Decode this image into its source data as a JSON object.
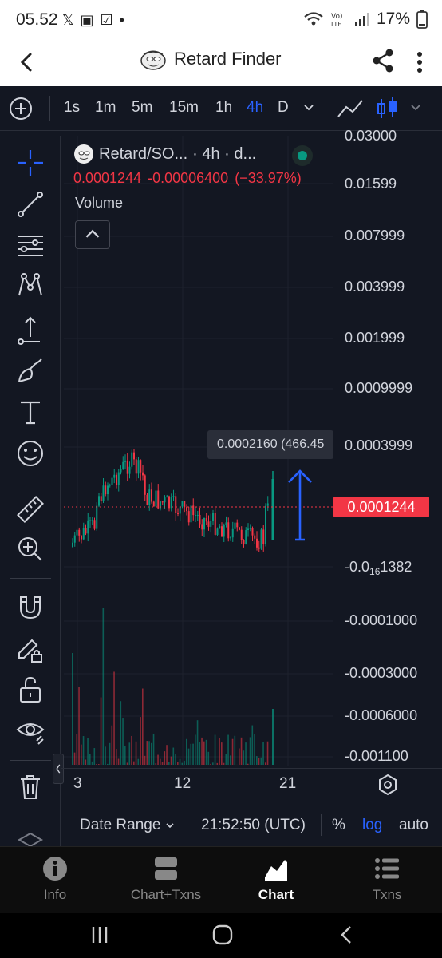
{
  "status": {
    "time": "05.52",
    "battery": "17%"
  },
  "app": {
    "title": "Retard Finder"
  },
  "toolbar": {
    "timeframes": [
      "1s",
      "1m",
      "5m",
      "15m",
      "1h",
      "4h",
      "D"
    ],
    "active_timeframe": "4h"
  },
  "legend": {
    "symbol": "Retard/SO...",
    "interval": "· 4h · d...",
    "last": "0.0001244",
    "change": "-0.00006400",
    "change_pct": "(−33.97%)",
    "volume_label": "Volume"
  },
  "price_axis": {
    "labels": [
      "0.03000",
      "0.01599",
      "0.007999",
      "0.003999",
      "0.001999",
      "0.0009999",
      "0.0003999",
      "-0.0001000",
      "-0.0003000",
      "-0.0006000",
      "-0.001100"
    ],
    "sub_label_prefix": "-0.0",
    "sub_label_sub": "16",
    "sub_label_suffix": "1382",
    "current_price": "0.0001244",
    "tooltip": "0.0002160 (466.45"
  },
  "time_axis": {
    "ticks": [
      "3",
      "12",
      "21"
    ]
  },
  "chart_bar": {
    "date_range": "Date Range",
    "clock": "21:52:50 (UTC)",
    "percent": "%",
    "log": "log",
    "auto": "auto"
  },
  "bottom_nav": {
    "items": [
      "Info",
      "Chart+Txns",
      "Chart",
      "Txns"
    ],
    "active": "Chart"
  },
  "colors": {
    "up": "#089981",
    "down": "#f23645",
    "accent": "#2962ff",
    "background": "#131722"
  }
}
